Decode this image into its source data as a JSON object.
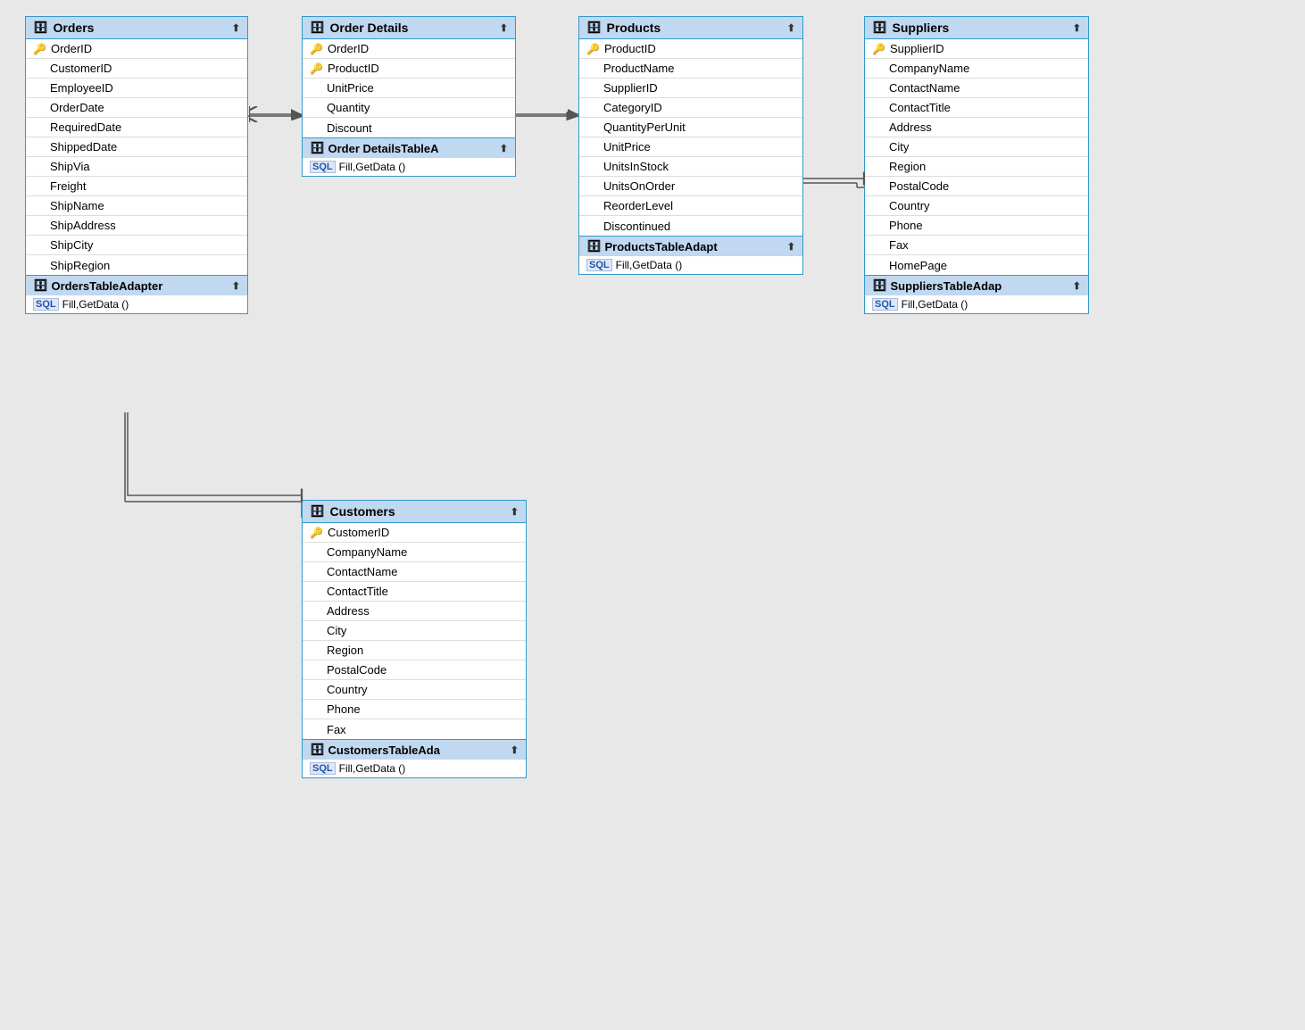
{
  "tables": {
    "orders": {
      "title": "Orders",
      "adapter": "OrdersTableAdapter",
      "footer": "Fill,GetData ()",
      "fields": [
        {
          "name": "OrderID",
          "key": true
        },
        {
          "name": "CustomerID",
          "key": false
        },
        {
          "name": "EmployeeID",
          "key": false
        },
        {
          "name": "OrderDate",
          "key": false
        },
        {
          "name": "RequiredDate",
          "key": false
        },
        {
          "name": "ShippedDate",
          "key": false
        },
        {
          "name": "ShipVia",
          "key": false
        },
        {
          "name": "Freight",
          "key": false
        },
        {
          "name": "ShipName",
          "key": false
        },
        {
          "name": "ShipAddress",
          "key": false
        },
        {
          "name": "ShipCity",
          "key": false
        },
        {
          "name": "ShipRegion",
          "key": false
        }
      ]
    },
    "orderDetails": {
      "title": "Order Details",
      "adapter": "Order DetailsTableA",
      "footer": "Fill,GetData ()",
      "fields": [
        {
          "name": "OrderID",
          "key": true
        },
        {
          "name": "ProductID",
          "key": true
        },
        {
          "name": "UnitPrice",
          "key": false
        },
        {
          "name": "Quantity",
          "key": false
        },
        {
          "name": "Discount",
          "key": false
        }
      ]
    },
    "products": {
      "title": "Products",
      "adapter": "ProductsTableAdapt",
      "footer": "Fill,GetData ()",
      "fields": [
        {
          "name": "ProductID",
          "key": true
        },
        {
          "name": "ProductName",
          "key": false
        },
        {
          "name": "SupplierID",
          "key": false
        },
        {
          "name": "CategoryID",
          "key": false
        },
        {
          "name": "QuantityPerUnit",
          "key": false
        },
        {
          "name": "UnitPrice",
          "key": false
        },
        {
          "name": "UnitsInStock",
          "key": false
        },
        {
          "name": "UnitsOnOrder",
          "key": false
        },
        {
          "name": "ReorderLevel",
          "key": false
        },
        {
          "name": "Discontinued",
          "key": false
        }
      ]
    },
    "suppliers": {
      "title": "Suppliers",
      "adapter": "SuppliersTableAdap",
      "footer": "Fill,GetData ()",
      "fields": [
        {
          "name": "SupplierID",
          "key": true
        },
        {
          "name": "CompanyName",
          "key": false
        },
        {
          "name": "ContactName",
          "key": false
        },
        {
          "name": "ContactTitle",
          "key": false
        },
        {
          "name": "Address",
          "key": false
        },
        {
          "name": "City",
          "key": false
        },
        {
          "name": "Region",
          "key": false
        },
        {
          "name": "PostalCode",
          "key": false
        },
        {
          "name": "Country",
          "key": false
        },
        {
          "name": "Phone",
          "key": false
        },
        {
          "name": "Fax",
          "key": false
        },
        {
          "name": "HomePage",
          "key": false
        }
      ]
    },
    "customers": {
      "title": "Customers",
      "adapter": "CustomersTableAda",
      "footer": "Fill,GetData ()",
      "fields": [
        {
          "name": "CustomerID",
          "key": true
        },
        {
          "name": "CompanyName",
          "key": false
        },
        {
          "name": "ContactName",
          "key": false
        },
        {
          "name": "ContactTitle",
          "key": false
        },
        {
          "name": "Address",
          "key": false
        },
        {
          "name": "City",
          "key": false
        },
        {
          "name": "Region",
          "key": false
        },
        {
          "name": "PostalCode",
          "key": false
        },
        {
          "name": "Country",
          "key": false
        },
        {
          "name": "Phone",
          "key": false
        },
        {
          "name": "Fax",
          "key": false
        }
      ]
    }
  }
}
